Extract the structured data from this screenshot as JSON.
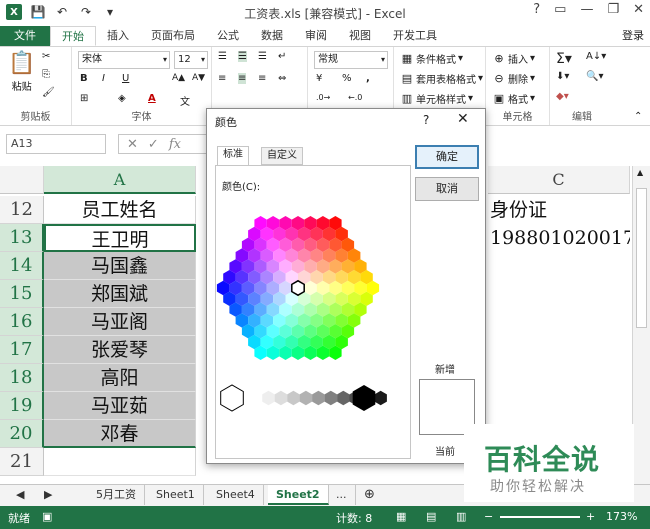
{
  "window": {
    "title": "工资表.xls  [兼容模式] - Excel",
    "login": "登录"
  },
  "tabs": [
    "文件",
    "开始",
    "插入",
    "页面布局",
    "公式",
    "数据",
    "审阅",
    "视图",
    "开发工具"
  ],
  "ribbon": {
    "clipboard_label": "剪贴板",
    "paste_label": "粘贴",
    "font_label": "字体",
    "font_name": "宋体",
    "font_size": "12",
    "number_format": "常规",
    "conditional_format": "条件格式",
    "table_format": "套用表格格式",
    "cell_style": "单元格样式",
    "insert": "插入",
    "delete": "删除",
    "format": "格式",
    "cells_label": "单元格",
    "edit_label": "编辑",
    "bold": "B",
    "italic": "I",
    "underline": "U",
    "percent": "%",
    "comma": ","
  },
  "formula_bar": {
    "name_box": "A13",
    "fx": "fx"
  },
  "grid": {
    "col_a": "A",
    "col_c": "C",
    "rows": [
      {
        "num": "12",
        "a": "员工姓名",
        "c": "身份证"
      },
      {
        "num": "13",
        "a": "王卫明",
        "c": "198801020017"
      },
      {
        "num": "14",
        "a": "马国鑫",
        "c": ""
      },
      {
        "num": "15",
        "a": "郑国斌",
        "c": ""
      },
      {
        "num": "16",
        "a": "马亚阁",
        "c": ""
      },
      {
        "num": "17",
        "a": "张爱琴",
        "c": ""
      },
      {
        "num": "18",
        "a": "高阳",
        "c": ""
      },
      {
        "num": "19",
        "a": "马亚茹",
        "c": ""
      },
      {
        "num": "20",
        "a": "邓春",
        "c": ""
      },
      {
        "num": "21",
        "a": "",
        "c": ""
      }
    ]
  },
  "sheets": [
    "5月工资",
    "Sheet1",
    "Sheet4",
    "Sheet2",
    "..."
  ],
  "status": {
    "ready": "就绪",
    "count": "计数: 8",
    "zoom": "173%"
  },
  "dialog": {
    "title": "颜色",
    "help": "?",
    "tab_standard": "标准",
    "tab_custom": "自定义",
    "colors_label": "颜色(C):",
    "ok": "确定",
    "cancel": "取消",
    "new_label": "新增",
    "current_label": "当前"
  },
  "watermark": {
    "main": "百科全说",
    "sub": "助你轻松解决"
  }
}
